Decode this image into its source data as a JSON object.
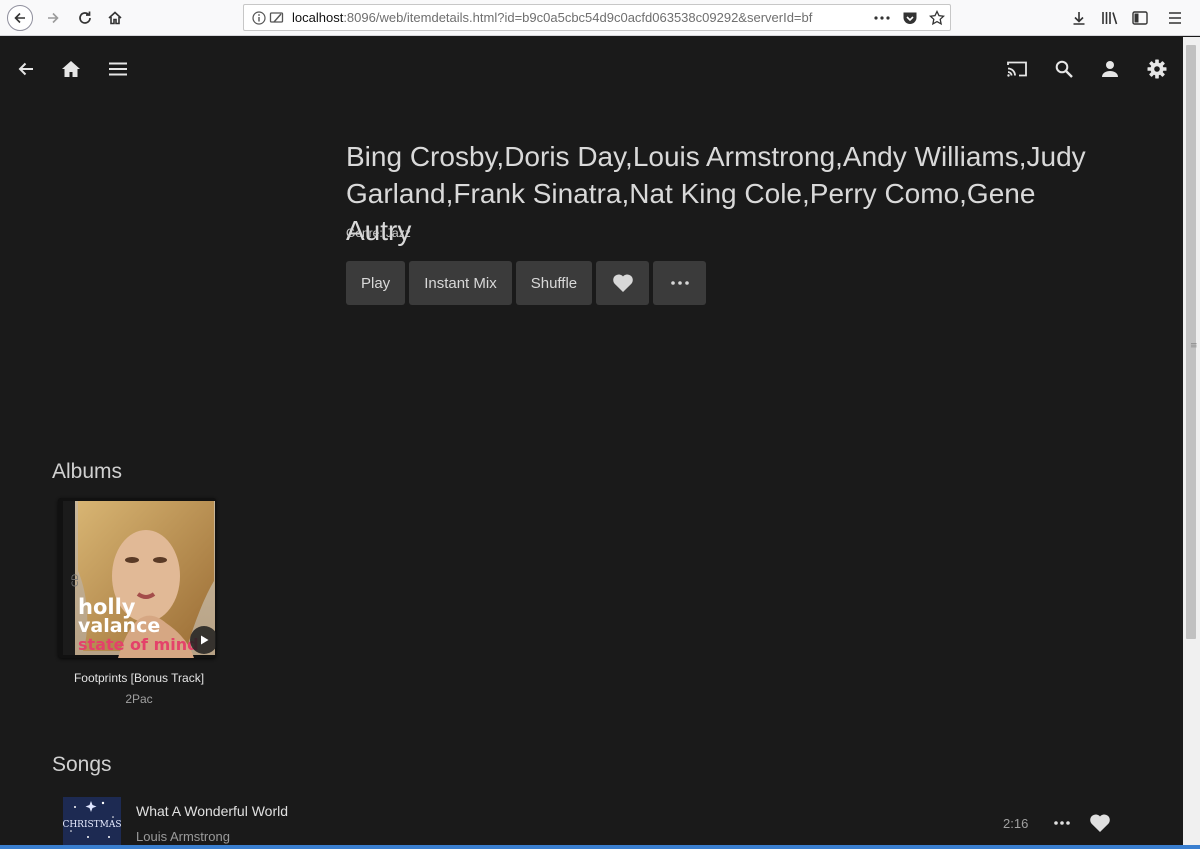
{
  "browser": {
    "url_host": "localhost",
    "url_rest": ":8096/web/itemdetails.html?id=b9c0a5cbc54d9c0acfd063538c09292&serverId=bf",
    "icons": [
      "back-icon",
      "forward-icon",
      "reload-icon",
      "home-icon",
      "info-icon",
      "page-actions-icon",
      "pocket-icon",
      "bookmark-star-icon",
      "download-icon",
      "library-icon",
      "sidebar-icon",
      "menu-icon"
    ]
  },
  "header": {
    "icons": [
      "back-arrow-icon",
      "home-icon",
      "hamburger-menu-icon",
      "cast-icon",
      "search-icon",
      "user-icon",
      "settings-gear-icon"
    ]
  },
  "artist": {
    "name": "Bing Crosby,Doris Day,Louis Armstrong,Andy Williams,Judy Garland,Frank Sinatra,Nat King Cole,Perry Como,Gene Autry",
    "genre": "Genre: Jazz"
  },
  "actions": {
    "play": "Play",
    "instant_mix": "Instant Mix",
    "shuffle": "Shuffle"
  },
  "albums": {
    "heading": "Albums",
    "items": [
      {
        "name": "Footprints [Bonus Track]",
        "artist": "2Pac",
        "cover_text_1": "holly",
        "cover_text_2": "valance",
        "cover_text_3": "state of mind"
      }
    ]
  },
  "songs": {
    "heading": "Songs",
    "items": [
      {
        "title": "What A Wonderful World",
        "artist": "Louis Armstrong",
        "duration": "2:16",
        "thumb_text": "CHRISTMAS"
      }
    ]
  },
  "colors": {
    "background": "#1a1a1a",
    "button": "#3b3b3b",
    "text": "#d9d9d9",
    "accent_strip": "#3a7fd0"
  }
}
